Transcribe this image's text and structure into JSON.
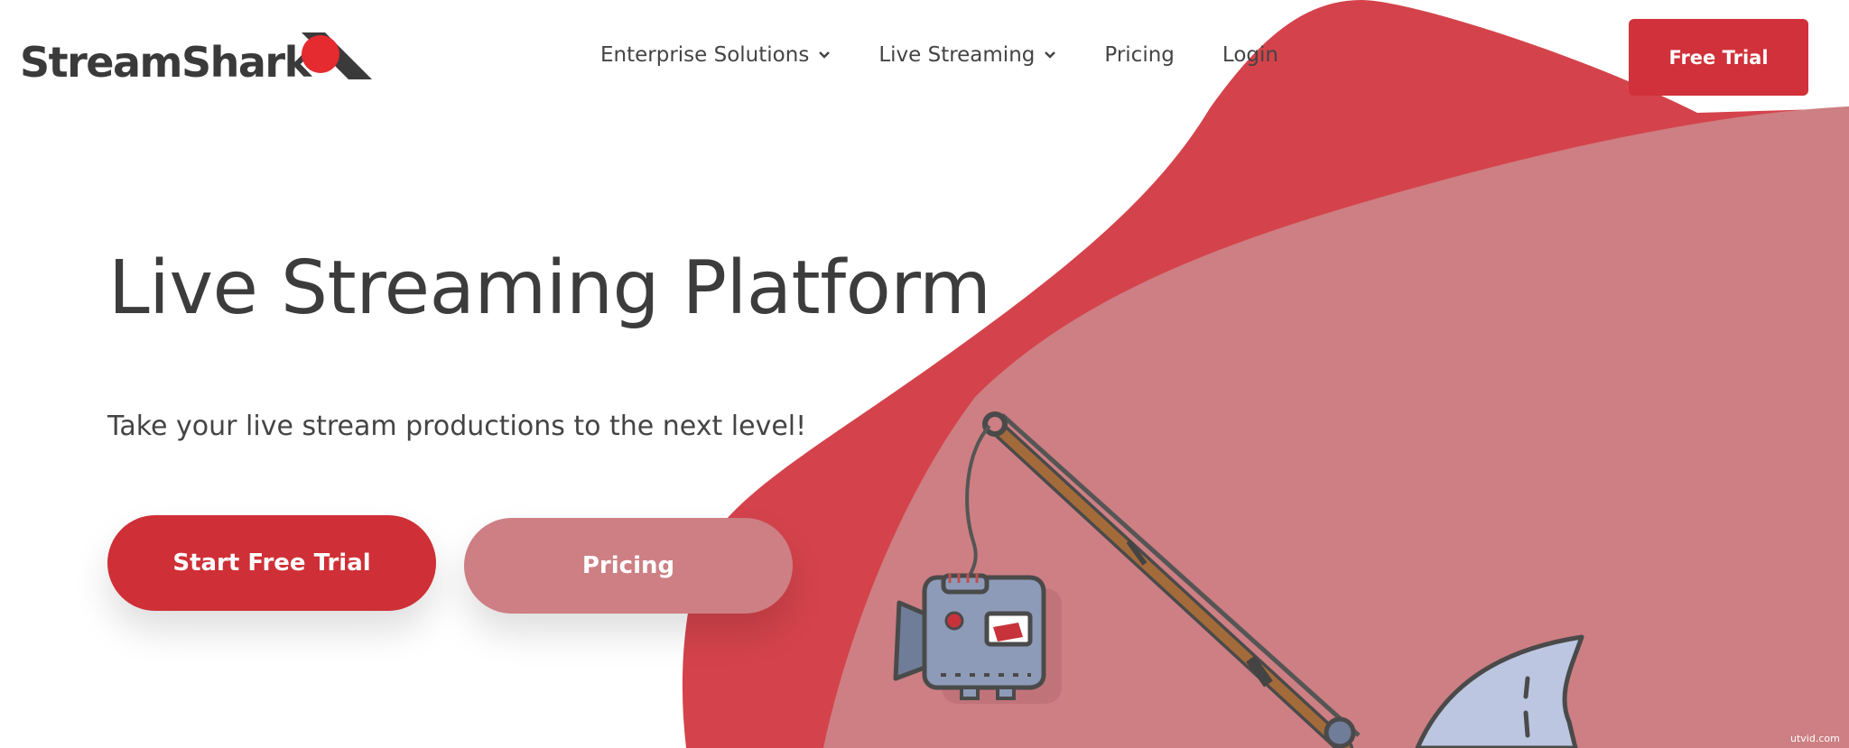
{
  "logo": {
    "text": "StreamShark",
    "icon": "shark-fin-record-icon"
  },
  "nav": {
    "items": [
      {
        "label": "Enterprise Solutions",
        "has_dropdown": true
      },
      {
        "label": "Live Streaming",
        "has_dropdown": true
      },
      {
        "label": "Pricing",
        "has_dropdown": false
      },
      {
        "label": "Login",
        "has_dropdown": false
      }
    ],
    "cta_label": "Free Trial"
  },
  "hero": {
    "title": "Live Streaming Platform",
    "subtitle": "Take your live stream productions to the next level!",
    "primary_button": "Start Free Trial",
    "secondary_button": "Pricing"
  },
  "illustration": {
    "items": [
      "fishing-rod-icon",
      "video-camera-icon",
      "shark-fin-icon"
    ]
  },
  "watermark": "utvid.com",
  "colors": {
    "brand_red": "#d0313a",
    "blob_red": "#d4434b",
    "blob_pink": "#cd7f83",
    "text_dark": "#3c3c3c"
  }
}
